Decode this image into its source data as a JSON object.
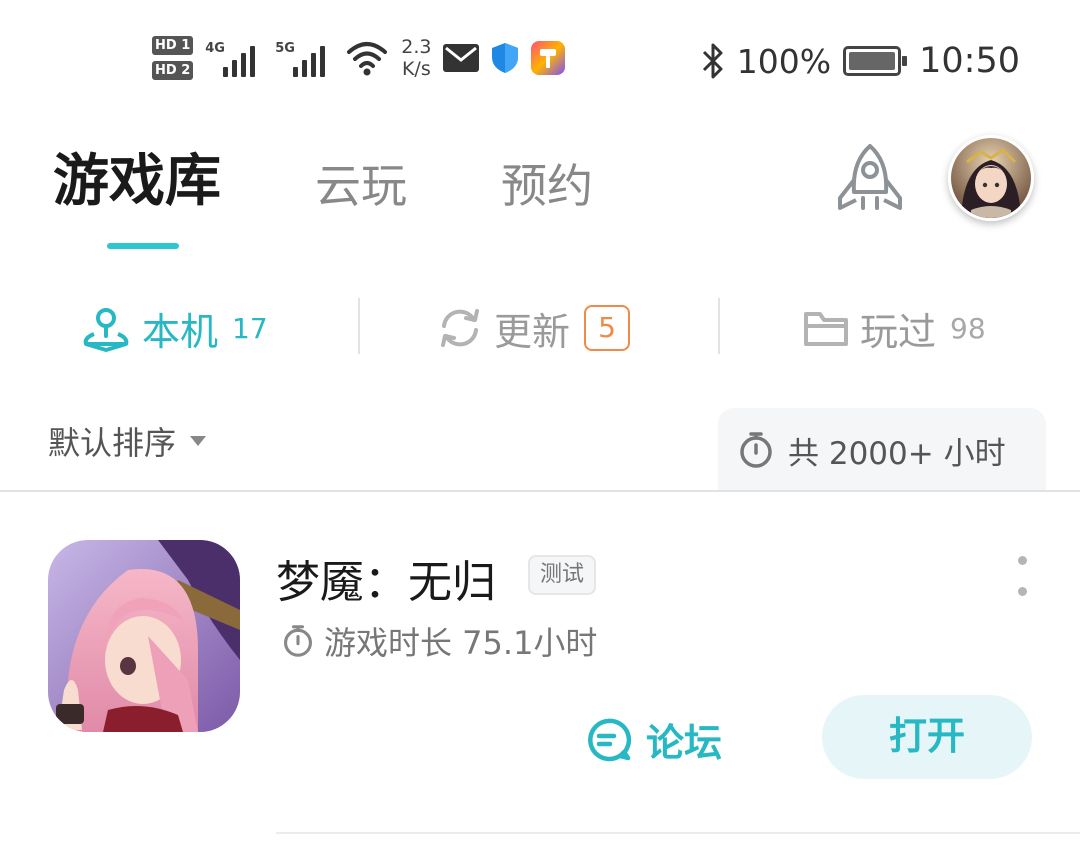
{
  "status_bar": {
    "hd1": "HD 1",
    "hd2": "HD 2",
    "net1": "4G",
    "net2": "5G",
    "speed_value": "2.3",
    "speed_unit": "K/s",
    "battery_percent": "100%",
    "time": "10:50",
    "icons": [
      "hd-icon",
      "signal-icon",
      "wifi-icon",
      "mail-icon",
      "shield-icon",
      "app-icon",
      "bluetooth-icon",
      "battery-icon"
    ]
  },
  "header": {
    "tabs": [
      {
        "label": "游戏库",
        "active": true
      },
      {
        "label": "云玩",
        "active": false
      },
      {
        "label": "预约",
        "active": false
      }
    ],
    "rocket_icon": "rocket-icon",
    "avatar_icon": "avatar"
  },
  "sub_tabs": [
    {
      "label": "本机",
      "count": "17",
      "icon": "local-device-icon",
      "active": true
    },
    {
      "label": "更新",
      "badge": "5",
      "icon": "refresh-icon",
      "active": false
    },
    {
      "label": "玩过",
      "count": "98",
      "icon": "folder-icon",
      "active": false
    }
  ],
  "sort": {
    "label": "默认排序"
  },
  "total": {
    "label": "共 2000+ 小时"
  },
  "games": [
    {
      "title": "梦魇：无归",
      "tag": "测试",
      "playtime": "游戏时长 75.1小时",
      "forum_label": "论坛",
      "open_label": "打开"
    }
  ],
  "colors": {
    "accent": "#27b8c3",
    "badge": "#f08a4b",
    "muted": "#9a9a9a"
  }
}
